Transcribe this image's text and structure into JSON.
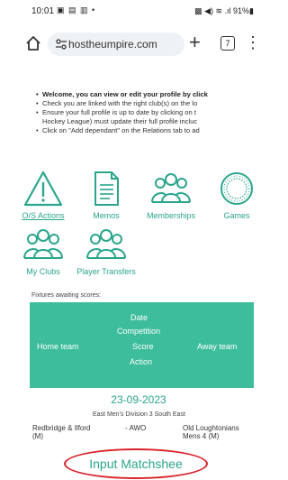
{
  "status_bar": {
    "time": "10:01",
    "left_icons": "▣ ▤ ▥ •",
    "right_text": "▩ ◀) ≋ .ıl 91%▮"
  },
  "browser": {
    "url": "hostheumpire.com",
    "tab_count": "7",
    "new_tab": "+",
    "menu": "⋮"
  },
  "notes": [
    "Welcome, you can view or edit your profile by click",
    "Check you are linked with the right club(s) on the lo",
    "Ensure your full profile is up to date by clicking on t",
    "Hockey League) must update their full profile incluc",
    "Click on \"Add dependant\" on the Relations tab to ad"
  ],
  "tiles": [
    {
      "label": "O/S Actions",
      "icon": "warning-triangle-icon"
    },
    {
      "label": "Memos",
      "icon": "memo-document-icon"
    },
    {
      "label": "Memberships",
      "icon": "people-group-icon"
    },
    {
      "label": "Games",
      "icon": "ball-icon"
    },
    {
      "label": "My Clubs",
      "icon": "people-group-icon"
    },
    {
      "label": "Player Transfers",
      "icon": "people-group-icon"
    }
  ],
  "fixtures": {
    "title": "Fixtures awaiting scores:",
    "headers": {
      "date": "Date",
      "competition": "Competition",
      "home": "Home team",
      "score": "Score",
      "away": "Away team",
      "action": "Action"
    },
    "row": {
      "date": "23-09-2023",
      "competition": "East Men's Division 3 South East",
      "home_line1": "Redbridge & Ilford",
      "home_line2": "(M)",
      "score": "- AWO",
      "away_line1": "Old Loughtonians",
      "away_line2": "Mens 4 (M)",
      "action": "Input Matchshee"
    }
  },
  "colors": {
    "accent": "#2aa58c",
    "header_bg": "#3dbd9c",
    "highlight_circle": "#d9222a"
  }
}
